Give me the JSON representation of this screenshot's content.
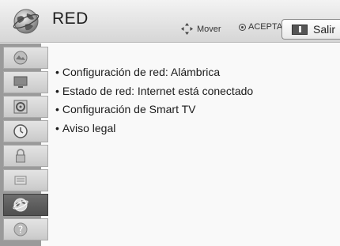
{
  "header": {
    "title": "RED",
    "hint_move": "Mover",
    "hint_accept": "ACEPTAR",
    "exit_label": "Salir",
    "logo_icon": "network-globe-icon"
  },
  "sidebar": {
    "items": [
      {
        "icon": "picture-icon",
        "active": false
      },
      {
        "icon": "monitor-icon",
        "active": false
      },
      {
        "icon": "audio-icon",
        "active": false
      },
      {
        "icon": "clock-icon",
        "active": false
      },
      {
        "icon": "lock-icon",
        "active": false
      },
      {
        "icon": "options-icon",
        "active": false
      },
      {
        "icon": "network-icon",
        "active": true
      },
      {
        "icon": "help-icon",
        "active": false
      }
    ]
  },
  "menu": {
    "items": [
      {
        "label": "Configuración de red: Alámbrica"
      },
      {
        "label": "Estado de red: Internet está conectado"
      },
      {
        "label": "Configuración de Smart TV"
      },
      {
        "label": "Aviso legal"
      }
    ]
  },
  "colors": {
    "header_top": "#f3f3f3",
    "header_bottom": "#d6d6d6",
    "sidebar_bg": "#9a9a9a",
    "active_item": "#5a5a5a"
  }
}
